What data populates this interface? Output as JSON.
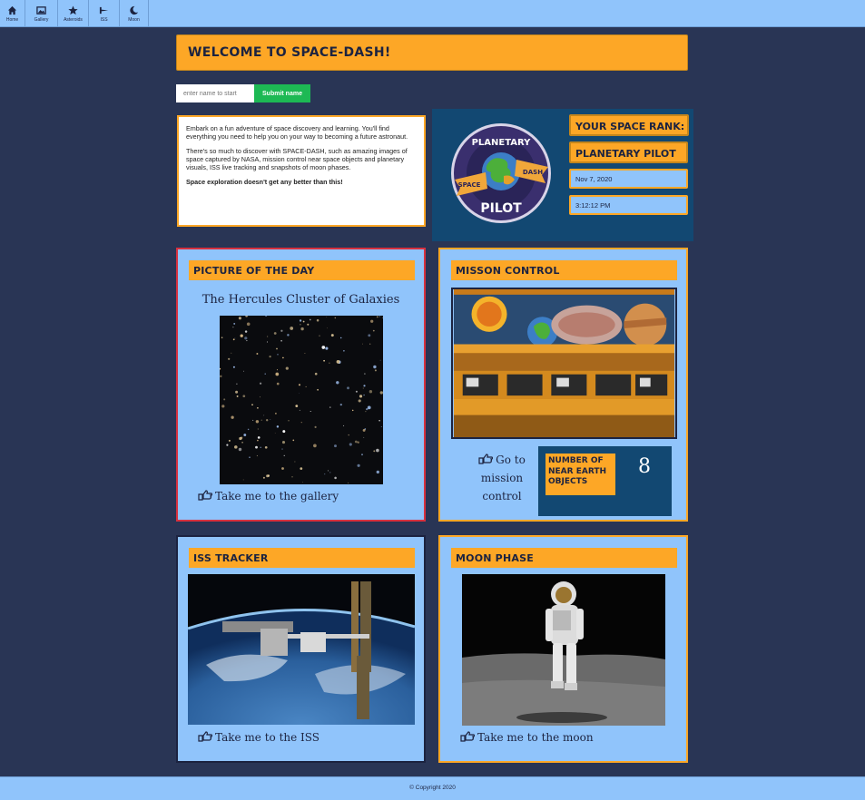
{
  "nav": {
    "items": [
      {
        "label": "Home",
        "icon": "home-icon"
      },
      {
        "label": "Gallery",
        "icon": "image-icon"
      },
      {
        "label": "Asteroids",
        "icon": "star-icon"
      },
      {
        "label": "ISS",
        "icon": "satellite-icon"
      },
      {
        "label": "Moon",
        "icon": "moon-icon"
      }
    ]
  },
  "welcome": {
    "title": "WELCOME TO SPACE-DASH!"
  },
  "name_form": {
    "placeholder": "enter name to start",
    "submit_label": "Submit name"
  },
  "intro": {
    "p1": "Embark on a fun adventure of space discovery and learning. You'll find everything you need to help you on your way to becoming a future astronaut.",
    "p2": "There's so much to discover with SPACE-DASH, such as amazing images of space captured by NASA, mission control near space objects and planetary visuals, ISS live tracking and snapshots of moon phases.",
    "p3": "Space exploration doesn't get any better than this!"
  },
  "rank": {
    "title": "YOUR SPACE RANK:",
    "value": "PLANETARY PILOT",
    "date": "Nov 7, 2020",
    "time": "3:12:12 PM",
    "badge": {
      "top_text": "PLANETARY",
      "left_text": "SPACE",
      "right_text": "DASH",
      "bottom_text": "PILOT"
    }
  },
  "potd": {
    "heading": "PICTURE OF THE DAY",
    "image_title": "The Hercules Cluster of Galaxies",
    "link": "Take me to the gallery"
  },
  "mission": {
    "heading": "MISSON CONTROL",
    "link": "Go to mission control",
    "neo_label": "NUMBER OF NEAR EARTH OBJECTS",
    "neo_count": "8"
  },
  "iss": {
    "heading": "ISS TRACKER",
    "link": "Take me to the ISS"
  },
  "moon": {
    "heading": "MOON PHASE",
    "link": "Take me to the moon"
  },
  "footer": {
    "copyright": "© Copyright 2020"
  },
  "colors": {
    "background": "#293555",
    "accent": "#fda726",
    "panel": "#90c4fb",
    "dark_panel": "#124872",
    "submit": "#1db954",
    "highlight_border": "#d7313f"
  }
}
